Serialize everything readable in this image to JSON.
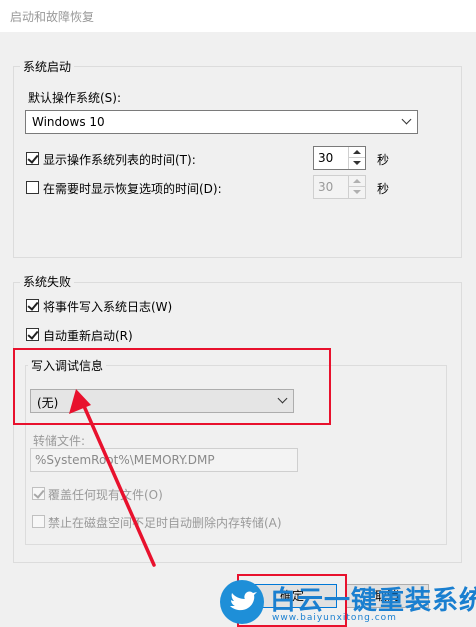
{
  "window": {
    "title": "启动和故障恢复"
  },
  "system_startup": {
    "group_title": "系统启动",
    "default_os_label": "默认操作系统(S):",
    "default_os_value": "Windows 10",
    "show_list": {
      "label": "显示操作系统列表的时间(T):",
      "checked": true,
      "value": "30",
      "unit": "秒"
    },
    "show_recovery": {
      "label": "在需要时显示恢复选项的时间(D):",
      "checked": false,
      "value": "30",
      "unit": "秒"
    }
  },
  "system_failure": {
    "group_title": "系统失败",
    "write_event": {
      "label": "将事件写入系统日志(W)",
      "checked": true
    },
    "auto_restart": {
      "label": "自动重新启动(R)",
      "checked": true
    },
    "debug": {
      "group_title": "写入调试信息",
      "value": "(无)",
      "dump_file_label": "转储文件:",
      "dump_file_value": "%SystemRoot%\\MEMORY.DMP",
      "overwrite": {
        "label": "覆盖任何现有文件(O)",
        "checked": true
      },
      "disable_autodelete": {
        "label": "禁止在磁盘空间不足时自动删除内存转储(A)",
        "checked": false
      }
    }
  },
  "buttons": {
    "ok": "确定",
    "cancel": "取消"
  },
  "watermark": {
    "main": "白云一键重装系统",
    "sub": "www.baiyunxitong.com"
  },
  "colors": {
    "highlight": "#e8112d",
    "accent": "#0078d7"
  }
}
